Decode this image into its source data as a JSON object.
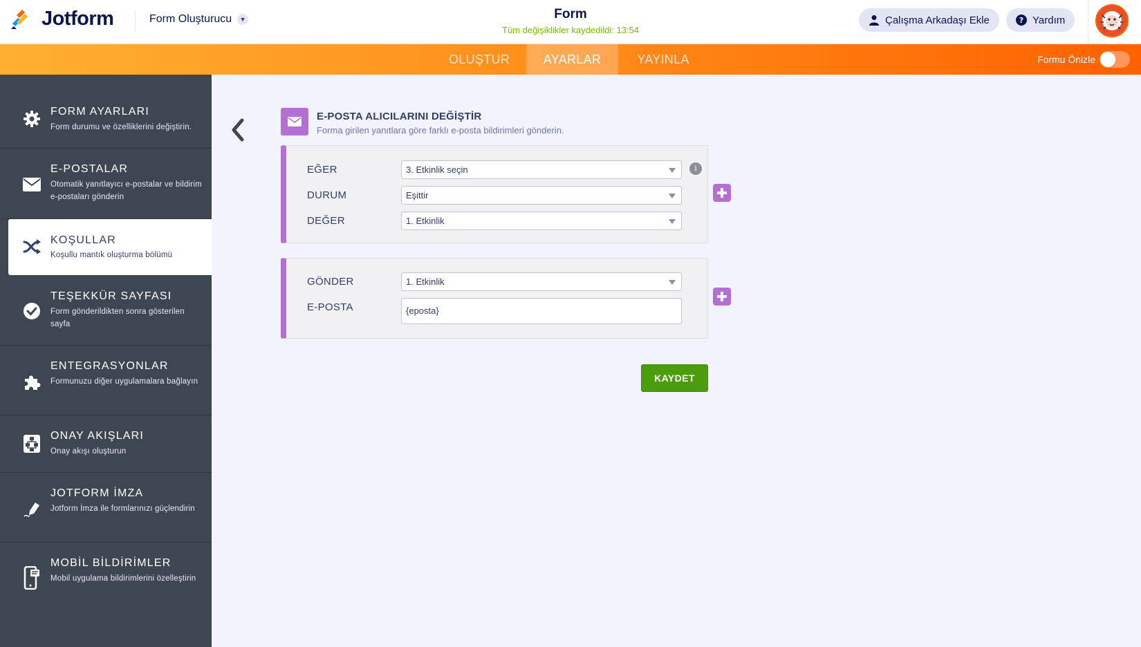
{
  "header": {
    "logo_text": "Jotform",
    "builder_menu_label": "Form Oluşturucu",
    "form_title": "Form",
    "save_status": "Tüm değişiklikler kaydedildi: 13:54",
    "add_collaborator_label": "Çalışma Arkadaşı Ekle",
    "help_label": "Yardım"
  },
  "nav": {
    "tabs": [
      {
        "label": "OLUŞTUR",
        "active": false
      },
      {
        "label": "AYARLAR",
        "active": true
      },
      {
        "label": "YAYINLA",
        "active": false
      }
    ],
    "preview_label": "Formu Önizle",
    "preview_enabled": false
  },
  "sidebar": {
    "items": [
      {
        "title": "FORM AYARLARI",
        "desc": "Form durumu ve özelliklerini değiştirin.",
        "icon": "gear-icon"
      },
      {
        "title": "E-POSTALAR",
        "desc": "Otomatik yanıtlayıcı e-postalar ve bildirim e-postaları gönderin",
        "icon": "envelope-icon"
      },
      {
        "title": "KOŞULLAR",
        "desc": "Koşullu mantık oluşturma bölümü",
        "icon": "shuffle-icon",
        "active": true
      },
      {
        "title": "TEŞEKKÜR SAYFASI",
        "desc": "Form gönderildikten sonra gösterilen sayfa",
        "icon": "check-circle-icon"
      },
      {
        "title": "ENTEGRASYONLAR",
        "desc": "Formunuzu diğer uygulamalara bağlayın",
        "icon": "puzzle-icon"
      },
      {
        "title": "ONAY AKIŞLARI",
        "desc": "Onay akışı oluşturun",
        "icon": "approval-flow-icon"
      },
      {
        "title": "JOTFORM İMZA",
        "desc": "Jotform İmza ile formlarınızı güçlendirin",
        "icon": "pen-icon"
      },
      {
        "title": "MOBİL BİLDİRİMLER",
        "desc": "Mobil uygulama bildirimlerini özelleştirin",
        "icon": "mobile-notification-icon"
      }
    ]
  },
  "condition": {
    "title": "E-POSTA ALICILARINI DEĞİŞTİR",
    "subtitle": "Forma girilen yanıtlara göre farklı e-posta bildirimleri gönderin.",
    "if_label": "EĞER",
    "if_value": "3. Etkinlik seçin",
    "state_label": "DURUM",
    "state_value": "Eşittir",
    "value_label": "DEĞER",
    "value_value": "1. Etkinlik",
    "send_label": "GÖNDER",
    "send_value": "1. Etkinlik",
    "email_label": "E-POSTA",
    "email_value": "{eposta}",
    "save_label": "KAYDET"
  },
  "colors": {
    "accent_orange": "#ff6100",
    "condition_purple": "#b46fd3",
    "save_green": "#4d9c0e",
    "status_green": "#78bb07",
    "sidebar_bg": "#3e4652"
  }
}
